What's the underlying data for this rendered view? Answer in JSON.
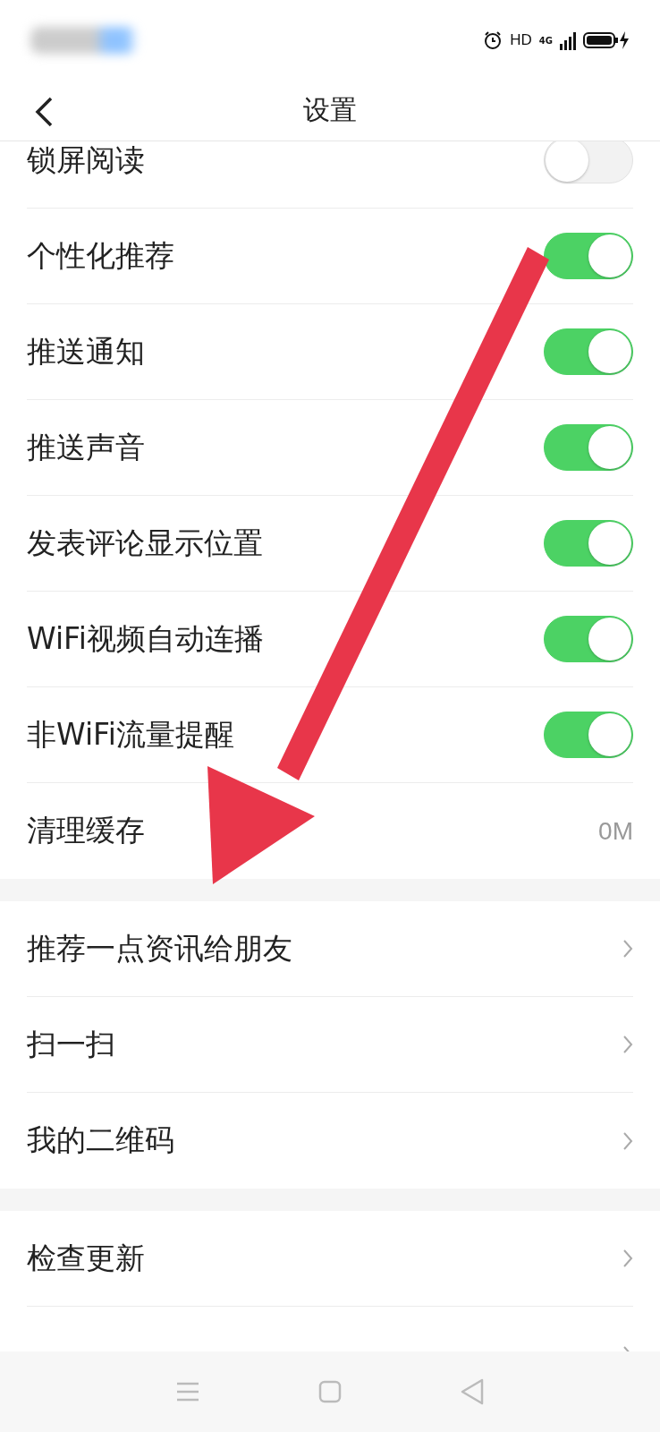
{
  "status_bar": {
    "network_label": "HD",
    "signal_label": "4G"
  },
  "header": {
    "title": "设置"
  },
  "sections": [
    {
      "items": [
        {
          "kind": "toggle",
          "label": "锁屏阅读",
          "on": false
        },
        {
          "kind": "toggle",
          "label": "个性化推荐",
          "on": true
        },
        {
          "kind": "toggle",
          "label": "推送通知",
          "on": true
        },
        {
          "kind": "toggle",
          "label": "推送声音",
          "on": true
        },
        {
          "kind": "toggle",
          "label": "发表评论显示位置",
          "on": true
        },
        {
          "kind": "toggle",
          "label": "WiFi视频自动连播",
          "on": true
        },
        {
          "kind": "toggle",
          "label": "非WiFi流量提醒",
          "on": true
        },
        {
          "kind": "value",
          "label": "清理缓存",
          "value": "0M"
        }
      ]
    },
    {
      "items": [
        {
          "kind": "link",
          "label": "推荐一点资讯给朋友"
        },
        {
          "kind": "link",
          "label": "扫一扫"
        },
        {
          "kind": "link",
          "label": "我的二维码"
        }
      ]
    },
    {
      "items": [
        {
          "kind": "link",
          "label": "检查更新"
        },
        {
          "kind": "link"
        }
      ]
    }
  ]
}
